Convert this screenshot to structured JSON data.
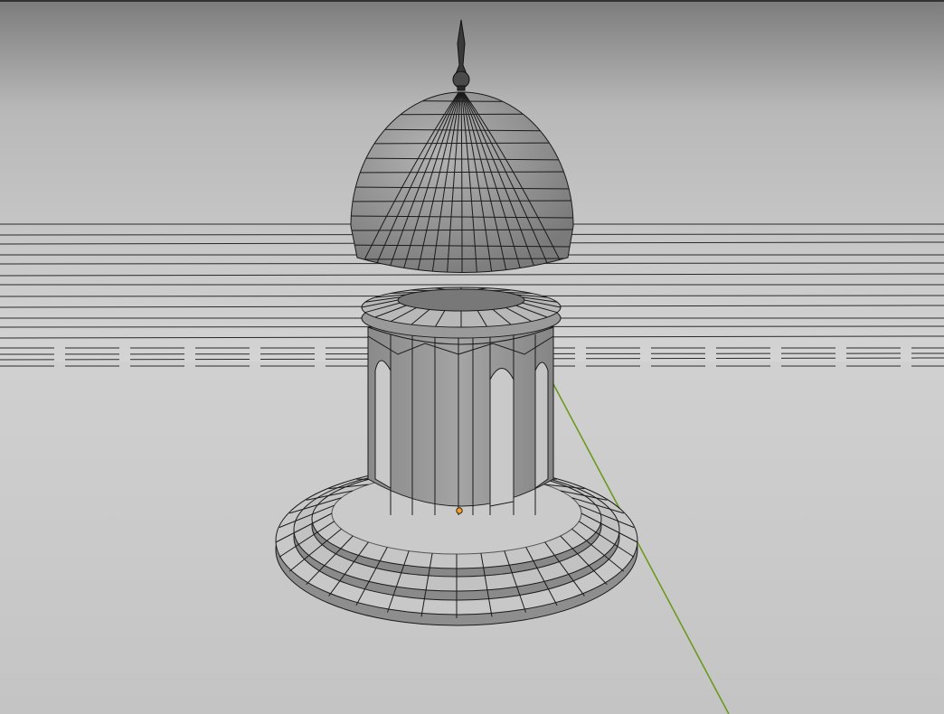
{
  "viewport": {
    "mode": "solid-wireframe",
    "background_top": "#8c8c8c",
    "background_horizon": "#d2d2d2",
    "floor": "#cfcfcf"
  },
  "scene": {
    "object": "gazebo-model",
    "parts": [
      "finial",
      "dome",
      "dome-rim",
      "colonnade",
      "stepped-base"
    ],
    "mesh_fill": "#8a8a8a",
    "mesh_fill_light": "#a6a6a6",
    "wire_color": "#1a1a1a"
  },
  "gizmo": {
    "y_axis_color": "#6b9a1e",
    "origin_color": "#f0a030"
  }
}
